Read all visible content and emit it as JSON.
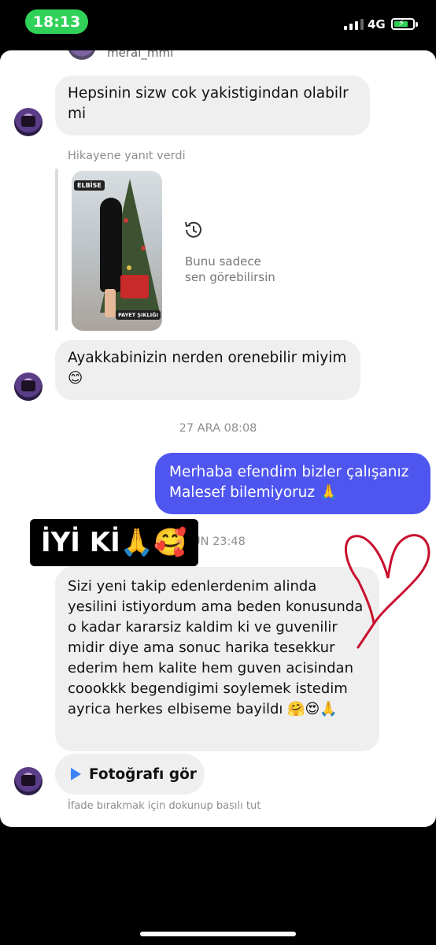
{
  "status_bar": {
    "time": "18:13",
    "network": "4G",
    "time_pill_color": "#30d158",
    "battery_charging": true
  },
  "chat": {
    "top_username": "meral_mmi",
    "messages_in": [
      "Hepsinin sizw cok yakistigindan olabilr mi",
      "Ayakkabinizin nerden orenebilir miyim 😊",
      "Sizi yeni takip edenlerdenim alinda yesilini istiyordum ama beden konusunda o kadar kararsiz kaldim ki ve guvenilir midir diye ama sonuc harika tesekkur ederim hem kalite hem guven acisindan coookkk begendigimi soylemek istedim ayrica herkes elbiseme bayildı 🤗😍🙏"
    ],
    "story_reply_label": "Hikayene yanıt verdi",
    "story": {
      "tag_top": "ELBİSE",
      "tag_bottom": "PAYET ŞIKLIĞI",
      "private_note_line1": "Bunu sadece",
      "private_note_line2": "sen görebilirsin",
      "icon": "history-icon"
    },
    "timestamp_1": "27 ARA 08:08",
    "message_out": "Merhaba efendim bizler çalışanız Malesef bilemiyoruz 🙏",
    "outgoing_bubble_color": "#4f56f0",
    "timestamp_2_partial": "ÜN 23:48",
    "sticker_text": "İYİ Kİ🙏🥰",
    "photo_button_label": "Fotoğrafı gör",
    "hint": "İfade bırakmak için dokunup basılı tut",
    "heart_color": "#c8102e"
  }
}
